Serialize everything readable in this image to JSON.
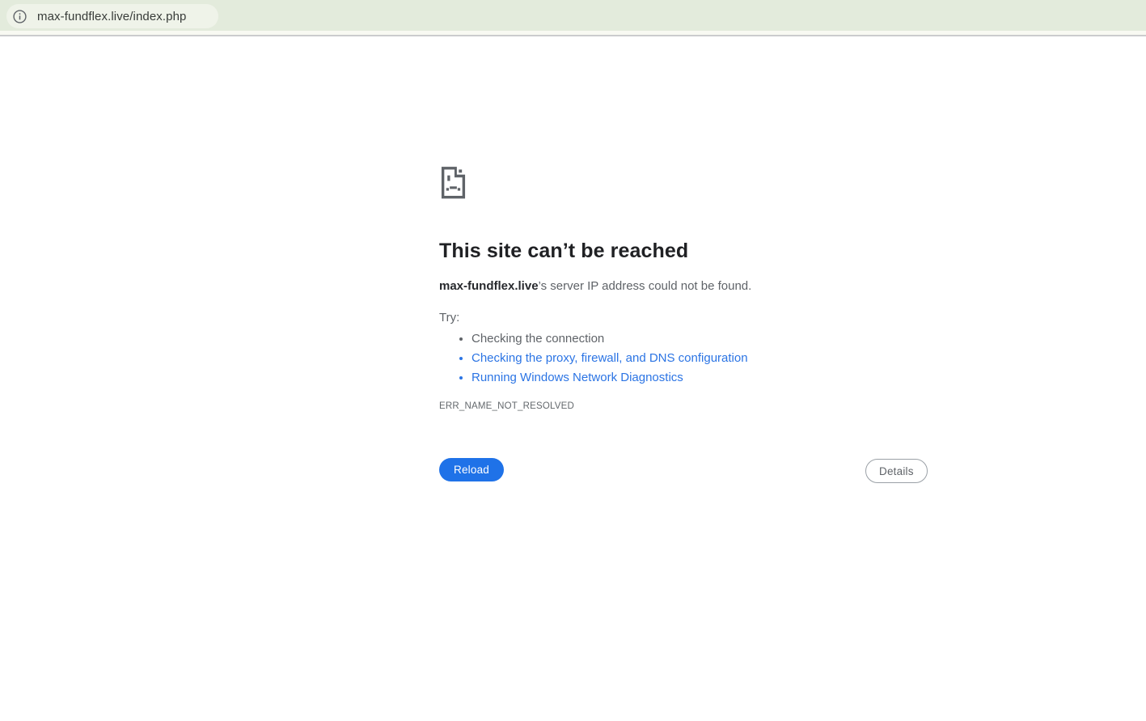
{
  "browser": {
    "url": "max-fundflex.live/index.php"
  },
  "error_page": {
    "title": "This site can’t be reached",
    "domain": "max-fundflex.live",
    "message_rest": "’s server IP address could not be found.",
    "try_label": "Try:",
    "suggestions": [
      {
        "label": "Checking the connection",
        "is_link": false
      },
      {
        "label": "Checking the proxy, firewall, and DNS configuration",
        "is_link": true
      },
      {
        "label": "Running Windows Network Diagnostics",
        "is_link": true
      }
    ],
    "error_code": "ERR_NAME_NOT_RESOLVED",
    "reload_label": "Reload",
    "details_label": "Details"
  },
  "colors": {
    "toolbar_background": "#e3ebdc",
    "url_pill_background": "#eff3e9",
    "link_blue": "#2b74e4",
    "reload_button_blue": "#1f72e8",
    "body_text_gray": "#5f6368",
    "title_text": "#202124"
  }
}
